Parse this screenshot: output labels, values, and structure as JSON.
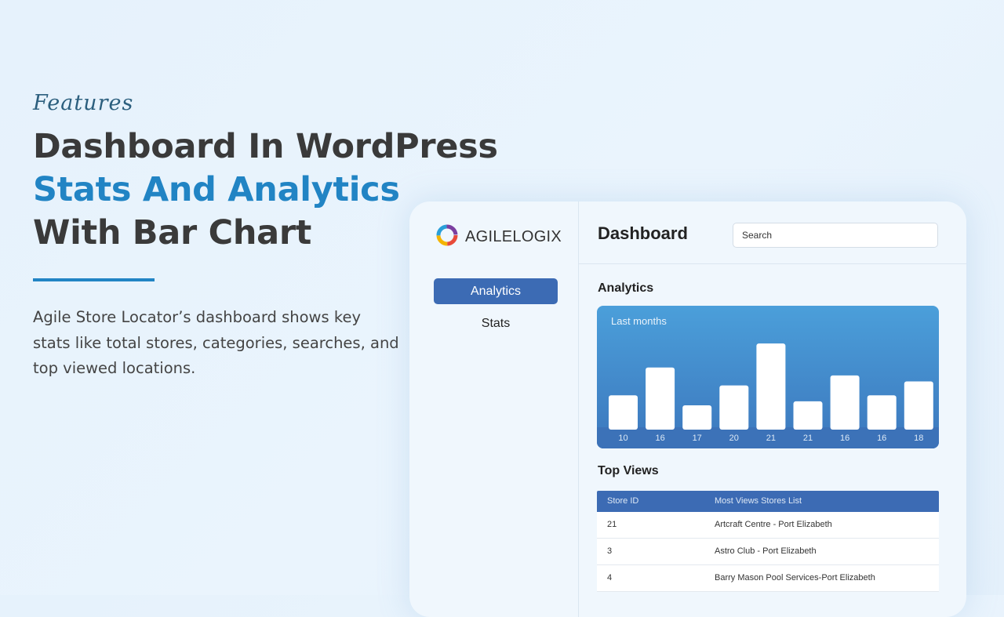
{
  "hero": {
    "eyebrow": "Features",
    "line1": "Dashboard In WordPress",
    "line2": "Stats And Analytics",
    "line3": "With Bar Chart",
    "description": "Agile Store Locator’s dashboard shows key stats like total stores, categories, searches, and top viewed locations."
  },
  "brand": {
    "name": "AGILELOGIX",
    "logo_icon": "swirl-logo-icon"
  },
  "sidebar": {
    "items": [
      {
        "label": "Analytics",
        "active": true
      },
      {
        "label": "Stats",
        "active": false
      }
    ]
  },
  "header": {
    "title": "Dashboard",
    "search_value": "Search"
  },
  "analytics": {
    "title": "Analytics",
    "card_subtitle": "Last months"
  },
  "chart_data": {
    "type": "bar",
    "title": "Last months",
    "categories": [
      "10",
      "16",
      "17",
      "20",
      "21",
      "21",
      "16",
      "16",
      "18"
    ],
    "values": [
      8,
      15,
      5.5,
      10.5,
      21,
      6.5,
      13,
      8,
      11.5
    ],
    "ylim": [
      0,
      23
    ],
    "grid": false,
    "legend": "none"
  },
  "top_views": {
    "title": "Top Views",
    "columns": [
      "Store ID",
      "Most Views Stores List"
    ],
    "rows": [
      [
        "21",
        "Artcraft Centre - Port Elizabeth"
      ],
      [
        "3",
        "Astro Club - Port Elizabeth"
      ],
      [
        "4",
        "Barry Mason Pool Services-Port Elizabeth"
      ]
    ]
  },
  "colors": {
    "accent": "#2184c4",
    "nav_active": "#3c6bb4",
    "chart_top": "#4b9fda",
    "chart_bottom": "#3c77bd"
  }
}
